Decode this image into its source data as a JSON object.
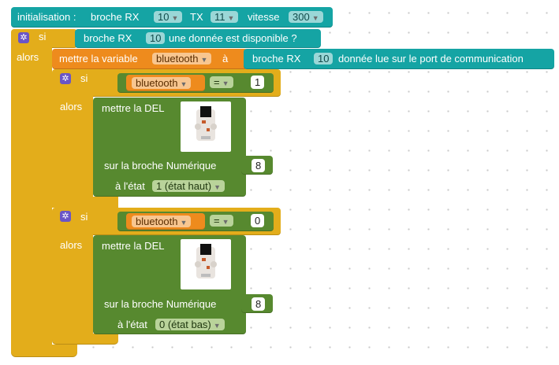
{
  "init": {
    "label": "initialisation :",
    "rx_label": "broche RX",
    "rx_value": "10",
    "tx_label": "TX",
    "tx_value": "11",
    "speed_label": "vitesse",
    "speed_value": "300"
  },
  "outer_if": {
    "si": "si",
    "alors": "alors",
    "condition_rx_label": "broche RX",
    "condition_rx_value": "10",
    "condition_text": "une donnée est disponible ?"
  },
  "set_var": {
    "label": "mettre la variable",
    "var_name": "bluetooth",
    "a": "à",
    "rx_label": "broche RX",
    "rx_value": "10",
    "read_text": "donnée lue sur le port de communication"
  },
  "if1": {
    "si": "si",
    "alors": "alors",
    "var_name": "bluetooth",
    "op": "=",
    "value": "1",
    "led_label": "mettre la DEL",
    "pin_label": "sur la broche Numérique",
    "pin_value": "8",
    "state_label": "à l'état",
    "state_value": "1 (état haut)"
  },
  "if2": {
    "si": "si",
    "alors": "alors",
    "var_name": "bluetooth",
    "op": "=",
    "value": "0",
    "led_label": "mettre la DEL",
    "pin_label": "sur la broche Numérique",
    "pin_value": "8",
    "state_label": "à l'état",
    "state_value": "0 (état bas)"
  },
  "icons": {
    "gear": "gear-icon",
    "dropdown": "dropdown-arrow-icon",
    "led_module": "led-module-image"
  },
  "colors": {
    "teal": "#15a4a4",
    "gold": "#e3ad1b",
    "orange": "#ee8b1d",
    "green": "#57892f",
    "gear": "#6a55c6"
  }
}
